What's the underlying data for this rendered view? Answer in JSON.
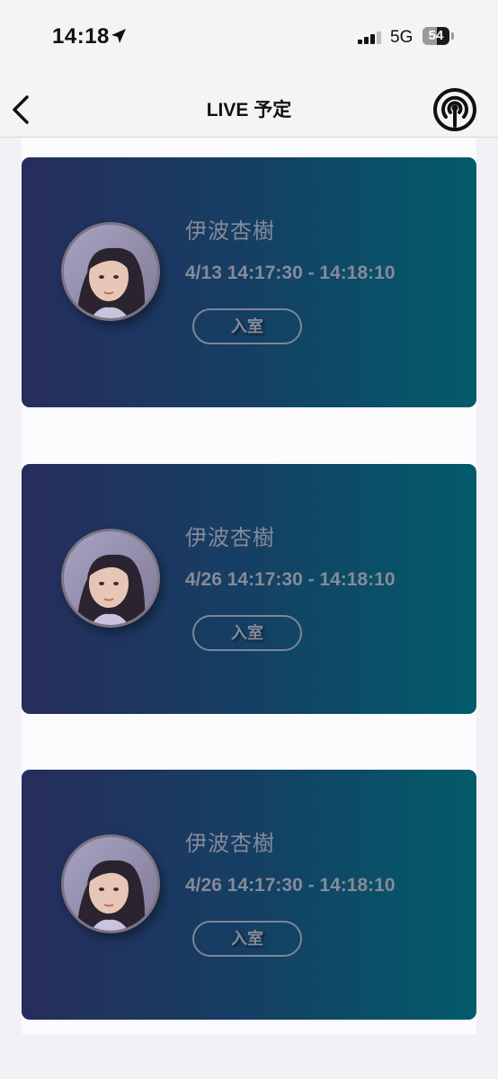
{
  "status_bar": {
    "time": "14:18",
    "network": "5G",
    "battery": "54",
    "battery_level": 0.54,
    "icons": [
      "location-arrow-icon",
      "signal-bars-icon",
      "battery-icon"
    ]
  },
  "nav": {
    "title": "LIVE 予定",
    "back_icon": "chevron-left-icon",
    "right_icon": "live-broadcast-icon"
  },
  "schedule": [
    {
      "name": "伊波杏樹",
      "time": "4/13 14:17:30 - 14:18:10",
      "button": "入室"
    },
    {
      "name": "伊波杏樹",
      "time": "4/26 14:17:30 - 14:18:10",
      "button": "入室"
    },
    {
      "name": "伊波杏樹",
      "time": "4/26 14:17:30 - 14:18:10",
      "button": "入室"
    }
  ],
  "colors": {
    "card_gradient_start": "#262d5c",
    "card_gradient_end": "#025b6a",
    "muted_text": "#868a98",
    "page_background": "#f1f1f6"
  }
}
